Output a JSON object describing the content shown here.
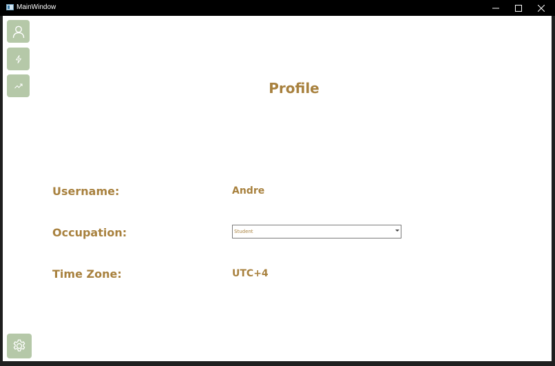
{
  "window": {
    "title": "MainWindow"
  },
  "profile": {
    "title": "Profile",
    "fields": [
      {
        "label": "Username:",
        "value": "Andre"
      },
      {
        "label": "Occupation:",
        "value": "Student"
      },
      {
        "label": "Time Zone:",
        "value": "UTC+4"
      }
    ]
  },
  "sidebar": {
    "buttons": [
      {
        "icon": "user-icon"
      },
      {
        "icon": "lightning-icon"
      },
      {
        "icon": "trending-up-icon"
      }
    ],
    "settings_icon": "gear-icon"
  },
  "colors": {
    "accent_text": "#a8813e",
    "sidebar_button": "#b5c8a8",
    "titlebar": "#000000",
    "content_background": "#ffffff"
  }
}
